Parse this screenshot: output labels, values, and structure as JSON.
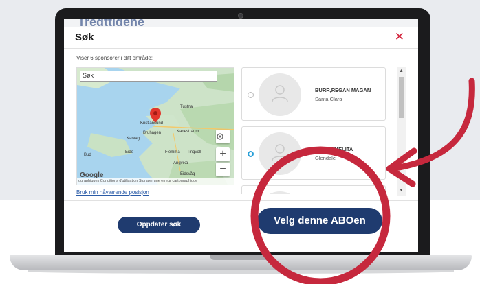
{
  "modal": {
    "title": "Søk",
    "close_icon": "close-icon",
    "info_text": "Viser 6 sponsorer i ditt område:",
    "behind_title": "Tredttidene"
  },
  "map": {
    "search_placeholder": "Søk",
    "labels": [
      "Tustna",
      "Kristiansund",
      "Bruhagen",
      "Karvag",
      "Kanestraum",
      "Bud",
      "Eide",
      "Flemma",
      "Tingvoll",
      "Angvika",
      "Eidsvåg"
    ],
    "footer_text": "ographiques  Conditions d'utilisation  Signaler une erreur cartographique",
    "logo_text": "Google",
    "zoom_in": "+",
    "zoom_out": "−",
    "location_link": "Bruk min nåværende posisjon"
  },
  "sponsors": [
    {
      "name": "BURR,REGAN MAGAN",
      "city": "Santa Clara",
      "selected": false
    },
    {
      "name": "…, CARMELITA",
      "city": "Glendale",
      "selected": true
    },
    {
      "name": "",
      "city": "",
      "selected": false
    }
  ],
  "buttons": {
    "update": "Oppdater søk",
    "select": "Velg denne ABOen"
  },
  "colors": {
    "brand": "#1f3b6f",
    "close": "#d3213a",
    "annotation": "#c6283d",
    "radio_selected": "#2aa0d8"
  }
}
